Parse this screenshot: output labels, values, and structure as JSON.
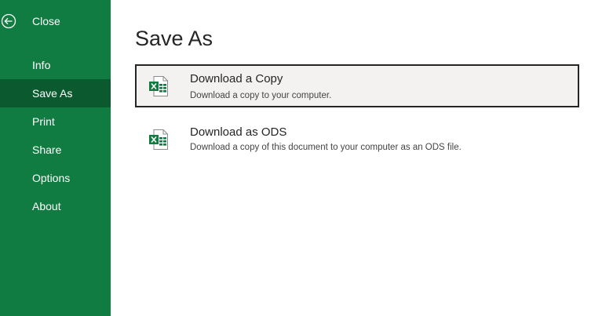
{
  "colors": {
    "sidebar_bg": "#107c41",
    "sidebar_selected_bg": "#0b5a2f",
    "text": "#252525",
    "option_selected_bg": "#f3f2f1"
  },
  "sidebar": {
    "close": {
      "label": "Close",
      "icon": "back-arrow-circle-icon"
    },
    "items": [
      {
        "label": "Info",
        "selected": false
      },
      {
        "label": "Save As",
        "selected": true
      },
      {
        "label": "Print",
        "selected": false
      },
      {
        "label": "Share",
        "selected": false
      },
      {
        "label": "Options",
        "selected": false
      },
      {
        "label": "About",
        "selected": false
      }
    ]
  },
  "main": {
    "title": "Save As",
    "options": [
      {
        "title": "Download a Copy",
        "description": "Download a copy to your computer.",
        "icon": "excel-file-icon",
        "selected": true
      },
      {
        "title": "Download as ODS",
        "description": "Download a copy of this document to your computer as an ODS file.",
        "icon": "excel-file-icon",
        "selected": false
      }
    ]
  }
}
